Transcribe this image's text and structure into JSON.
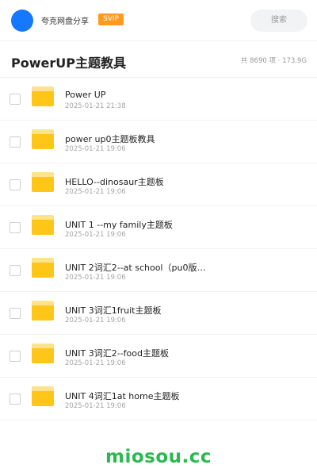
{
  "header": {
    "share_name": "夸克网盘分享",
    "badge": "SVIP",
    "search_placeholder": "搜索",
    "avatar_color": "#1677ff",
    "badge_color": "#ff9a1f"
  },
  "folder_header": {
    "title": "PowerUP主题教具",
    "stats": "共 8690 项 · 173.9G"
  },
  "items": [
    {
      "name": "Power UP",
      "date": "2025-01-21 21:38",
      "icon": "folder-icon"
    },
    {
      "name": "power up0主题板教具",
      "date": "2025-01-21 19:06",
      "icon": "folder-icon"
    },
    {
      "name": "HELLO--dinosaur主题板",
      "date": "2025-01-21 19:06",
      "icon": "folder-icon"
    },
    {
      "name": "UNIT 1 --my family主题板",
      "date": "2025-01-21 19:06",
      "icon": "folder-icon"
    },
    {
      "name": "UNIT 2词汇2--at school（pu0版…",
      "date": "2025-01-21 19:06",
      "icon": "folder-icon"
    },
    {
      "name": "UNIT 3词汇1fruit主题板",
      "date": "2025-01-21 19:06",
      "icon": "folder-icon"
    },
    {
      "name": "UNIT 3词汇2--food主题板",
      "date": "2025-01-21 19:06",
      "icon": "folder-icon"
    },
    {
      "name": "UNIT 4词汇1at home主题板",
      "date": "2025-01-21 19:06",
      "icon": "folder-icon"
    }
  ],
  "watermark": "miosou.cc",
  "colors": {
    "folder": "#ffc61a",
    "watermark": "#2bb84f"
  }
}
